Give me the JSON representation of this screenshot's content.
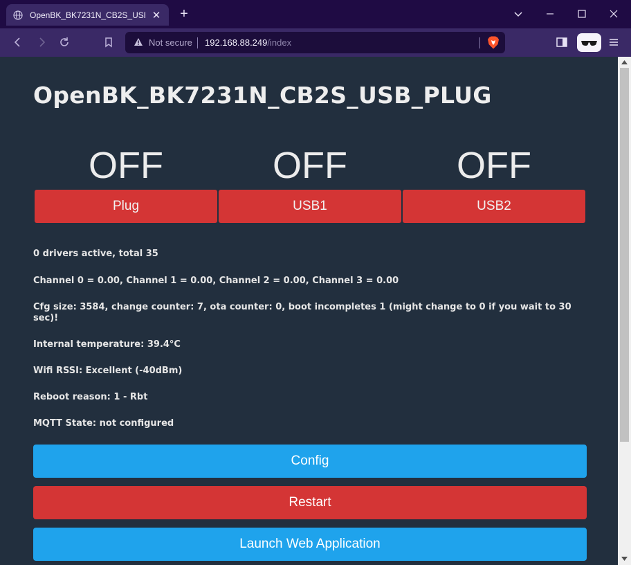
{
  "browser": {
    "tab_title": "OpenBK_BK7231N_CB2S_USB_PLUG",
    "security_label": "Not secure",
    "url_host": "192.168.88.249",
    "url_path": "/index",
    "new_tab_glyph": "+",
    "close_tab_glyph": "✕"
  },
  "page": {
    "title": "OpenBK_BK7231N_CB2S_USB_PLUG",
    "channels": [
      {
        "state": "OFF",
        "label": "Plug"
      },
      {
        "state": "OFF",
        "label": "USB1"
      },
      {
        "state": "OFF",
        "label": "USB2"
      }
    ],
    "info": [
      "0 drivers active, total 35",
      "Channel 0 = 0.00, Channel 1 = 0.00, Channel 2 = 0.00, Channel 3 = 0.00",
      "Cfg size: 3584, change counter: 7, ota counter: 0, boot incompletes 1 (might change to 0 if you wait to 30 sec)!",
      "Internal temperature: 39.4°C",
      "Wifi RSSI: Excellent (-40dBm)",
      "Reboot reason: 1 - Rbt",
      "MQTT State: not configured"
    ],
    "buttons": {
      "config": "Config",
      "restart": "Restart",
      "launch": "Launch Web Application"
    }
  },
  "colors": {
    "page_bg": "#222f3e",
    "button_blue": "#1fa3ec",
    "button_red": "#d43535"
  }
}
